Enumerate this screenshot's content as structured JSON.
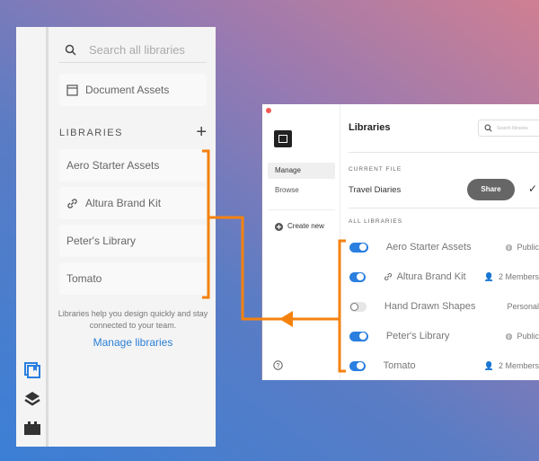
{
  "left_panel": {
    "search_placeholder": "Search all libraries",
    "document_assets": "Document Assets",
    "libraries_heading": "LIBRARIES",
    "add_label": "+",
    "libraries": [
      "Aero Starter Assets",
      "Altura Brand Kit",
      "Peter's Library",
      "Tomato"
    ],
    "help_text": "Libraries help you design quickly and stay connected to your team.",
    "manage_link": "Manage libraries"
  },
  "window": {
    "nav": {
      "manage": "Manage",
      "browse": "Browse",
      "create_new": "Create new"
    },
    "title": "Libraries",
    "search_placeholder": "Search libraries",
    "current_file_heading": "CURRENT FILE",
    "current_file": "Travel Diaries",
    "share_label": "Share",
    "all_libraries_heading": "ALL LIBRARIES",
    "libraries": [
      {
        "name": "Aero Starter Assets",
        "enabled": true,
        "meta": "Public"
      },
      {
        "name": "Altura Brand Kit",
        "enabled": true,
        "meta": "2 Members"
      },
      {
        "name": "Hand Drawn Shapes",
        "enabled": false,
        "meta": "Personal"
      },
      {
        "name": "Peter's Library",
        "enabled": true,
        "meta": "Public"
      },
      {
        "name": "Tomato",
        "enabled": true,
        "meta": "2 Members"
      }
    ]
  },
  "colors": {
    "accent": "#2a7fe0",
    "annotation": "#f5820f"
  }
}
